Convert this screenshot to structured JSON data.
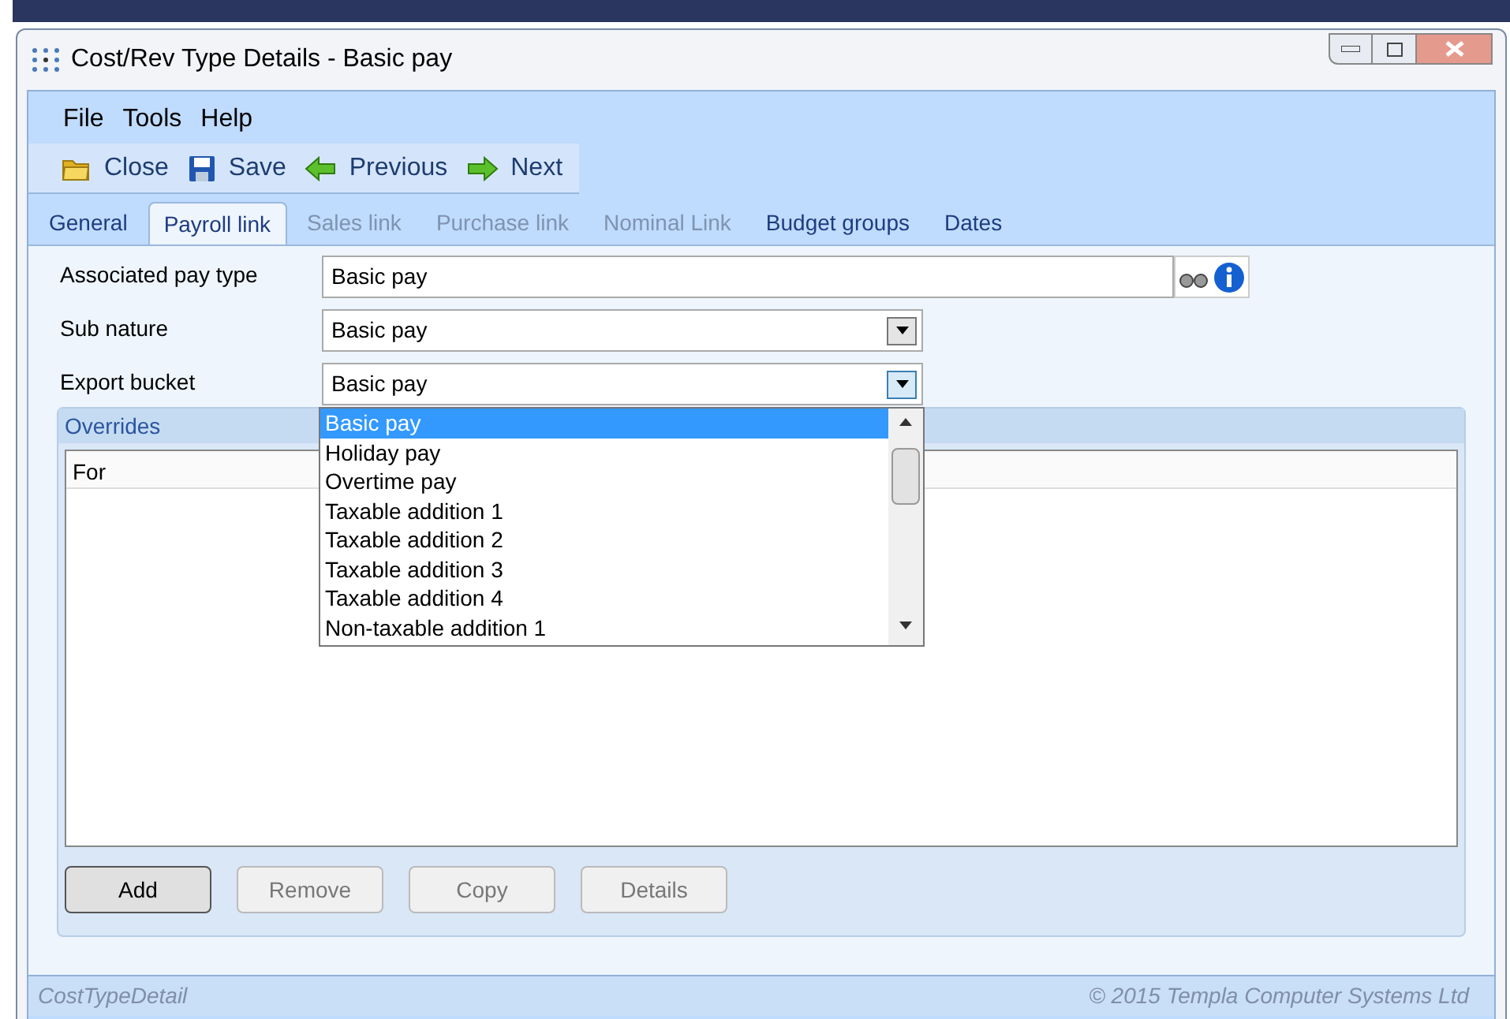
{
  "window": {
    "title": "Cost/Rev Type Details - Basic pay"
  },
  "menu": [
    "File",
    "Tools",
    "Help"
  ],
  "toolbar": [
    {
      "label": "Close",
      "kind": "folder"
    },
    {
      "label": "Save",
      "kind": "disk"
    },
    {
      "label": "Previous",
      "kind": "left"
    },
    {
      "label": "Next",
      "kind": "right"
    }
  ],
  "tabs": [
    {
      "label": "General",
      "selected": false,
      "disabled": false
    },
    {
      "label": "Payroll link",
      "selected": true,
      "disabled": false
    },
    {
      "label": "Sales link",
      "selected": false,
      "disabled": true
    },
    {
      "label": "Purchase link",
      "selected": false,
      "disabled": true
    },
    {
      "label": "Nominal Link",
      "selected": false,
      "disabled": true
    },
    {
      "label": "Budget groups",
      "selected": false,
      "disabled": false
    },
    {
      "label": "Dates",
      "selected": false,
      "disabled": false
    }
  ],
  "fields": [
    {
      "label": "Associated pay type",
      "value": "Basic pay",
      "kind": "lookup"
    },
    {
      "label": "Sub nature",
      "value": "Basic pay",
      "kind": "dropdown",
      "expanded": false
    },
    {
      "label": "Export bucket",
      "value": "Basic pay",
      "kind": "dropdown",
      "expanded": true
    }
  ],
  "dropdown_options": [
    {
      "label": "Basic pay",
      "selected": true
    },
    {
      "label": "Holiday pay",
      "selected": false
    },
    {
      "label": "Overtime pay",
      "selected": false
    },
    {
      "label": "Taxable addition 1",
      "selected": false
    },
    {
      "label": "Taxable addition 2",
      "selected": false
    },
    {
      "label": "Taxable addition 3",
      "selected": false
    },
    {
      "label": "Taxable addition 4",
      "selected": false
    },
    {
      "label": "Non-taxable addition 1",
      "selected": false
    }
  ],
  "overrides": {
    "title": "Overrides",
    "columns": [
      "For"
    ]
  },
  "buttons": [
    {
      "label": "Add",
      "disabled": false
    },
    {
      "label": "Remove",
      "disabled": true
    },
    {
      "label": "Copy",
      "disabled": true
    },
    {
      "label": "Details",
      "disabled": true
    }
  ],
  "status_bar": {
    "left": "CostTypeDetail",
    "right": "© 2015 Templa Computer Systems Ltd"
  }
}
